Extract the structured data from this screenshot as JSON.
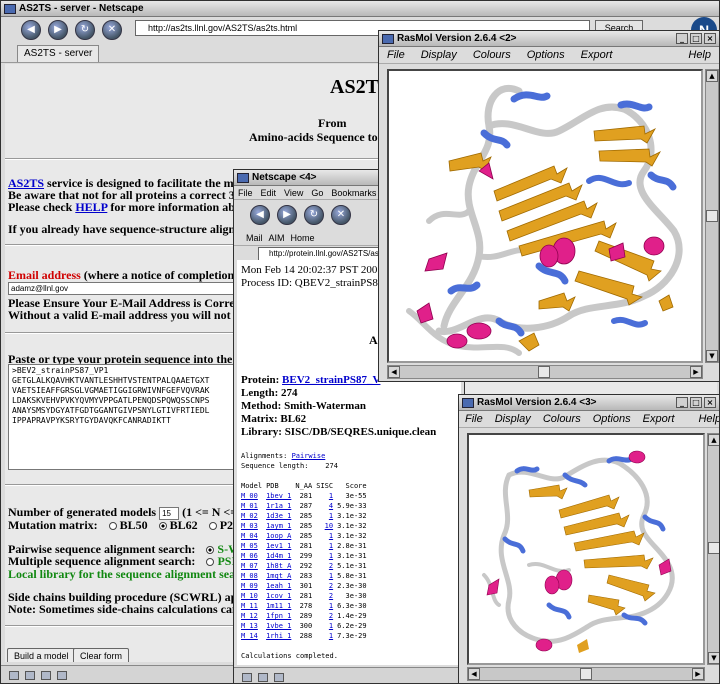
{
  "main_window": {
    "title": "AS2TS - server - Netscape",
    "url": "http://as2ts.llnl.gov/AS2TS/as2ts.html",
    "search_label": "Search",
    "logo_letter": "N",
    "tab_label": "AS2TS - server"
  },
  "page": {
    "title": "AS2TS",
    "from": "From",
    "subtitle": "Amino-acids Sequence to T",
    "intro_link": "AS2TS",
    "intro_text": " service is designed to facilitate the mode",
    "warn_text": "Be aware that not for all proteins a correct 3D m",
    "check_text": "Please check ",
    "help_link": "HELP",
    "check_text2": " for more information about",
    "already_text": "If you already have sequence-structure alignme",
    "email_label": "Email address",
    "email_note": " (where a notice of completion wil",
    "email_value": "adamz@llnl.gov",
    "ensure_text": "Please Ensure Your E-Mail Address is Correct a",
    "without_text": "Without a valid E-mail address you will not rece",
    "paste_text": "Paste or type your protein sequence into the box",
    "sequence": ">BEV2_strainPS87_VP1\nGETGLALKQAVHKTVANTLESHHTVSTENTPALQAAETGXT\nVAETSIEAFFGRSGLVGMAETIGGIGRWIVNFGEFVQVRAK\nLDAKSKVEHVPVKYQVMYVPPGATLPENQDSPQWQSSCNPS\nANAYSMSYDGYATFGDTGGANTGIVPSNYLGTIVFRTIEDL\nIPPAPRAVPYKSRYTGYDAVQKFCANRADIKTT",
    "models_label": "Number of generated models",
    "models_value": "15",
    "models_hint": "(1 <= N <= 4",
    "matrix_label": "Mutation matrix:",
    "matrix_opts": [
      "BL50",
      "BL62",
      "P25"
    ],
    "pairwise_label": "Pairwise sequence alignment search:",
    "pairwise_opt": "S-W",
    "multiple_label": "Multiple sequence alignment search:",
    "multiple_opt": "PSI-B",
    "local_lib": "Local library for the sequence alignment search",
    "side_chain": "Side chains building procedure (SCWRL) applic",
    "note_text": "Note: Sometimes side-chains calculations can ta",
    "build_btn": "Build a model",
    "clear_btn": "Clear form"
  },
  "ns4": {
    "title": "Netscape <4>",
    "menu": [
      "File",
      "Edit",
      "View",
      "Go",
      "Bookmarks",
      "T"
    ],
    "personal": [
      "Mail",
      "AIM",
      "Home"
    ],
    "url": "http://protein.llnl.gov/AS2TS/as2",
    "date_line": "Mon Feb 14 20:02:37 PST 200",
    "process_line": "Process ID: QBEV2_strainPS8",
    "letter_a": "A",
    "protein_label": "Protein: ",
    "protein_link": "BEV2_strainPS87_V",
    "length": "Length: 274",
    "method": "Method: Smith-Waterman",
    "matrix": "Matrix: BL62",
    "library": "Library: SISC/DB/SEQRES.unique.clean",
    "alignments_label": "Alignments: ",
    "alignments_link": "Pairwise",
    "seq_length": "Sequence length:    274",
    "headers": [
      "Model",
      "PDB",
      "N_AA",
      "SISC",
      "Score"
    ],
    "rows": [
      {
        "model": "M 00",
        "pdb": "1bev 1",
        "naa": "281",
        "sisc": "1",
        "score": "3e-55"
      },
      {
        "model": "M 01",
        "pdb": "1r1a 1",
        "naa": "287",
        "sisc": "4",
        "score": "5.9e-33"
      },
      {
        "model": "M 02",
        "pdb": "1d3e 1",
        "naa": "285",
        "sisc": "1",
        "score": "3.1e-32"
      },
      {
        "model": "M 03",
        "pdb": "1aym 1",
        "naa": "285",
        "sisc": "10",
        "score": "3.1e-32"
      },
      {
        "model": "M 04",
        "pdb": "1oop A",
        "naa": "285",
        "sisc": "1",
        "score": "3.1e-32"
      },
      {
        "model": "M 05",
        "pdb": "1ev1 1",
        "naa": "281",
        "sisc": "1",
        "score": "2.8e-31"
      },
      {
        "model": "M 06",
        "pdb": "1d4m 1",
        "naa": "299",
        "sisc": "1",
        "score": "3.1e-31"
      },
      {
        "model": "M 07",
        "pdb": "1h8t A",
        "naa": "292",
        "sisc": "2",
        "score": "5.1e-31"
      },
      {
        "model": "M 08",
        "pdb": "1mqt A",
        "naa": "283",
        "sisc": "1",
        "score": "5.8e-31"
      },
      {
        "model": "M 09",
        "pdb": "1eah 1",
        "naa": "301",
        "sisc": "2",
        "score": "2.3e-30"
      },
      {
        "model": "M 10",
        "pdb": "1cov 1",
        "naa": "281",
        "sisc": "2",
        "score": "3e-30"
      },
      {
        "model": "M 11",
        "pdb": "1m11 1",
        "naa": "278",
        "sisc": "1",
        "score": "6.3e-30"
      },
      {
        "model": "M 12",
        "pdb": "1fpn 1",
        "naa": "289",
        "sisc": "2",
        "score": "1.4e-29"
      },
      {
        "model": "M 13",
        "pdb": "1vbe 1",
        "naa": "300",
        "sisc": "1",
        "score": "6.2e-29"
      },
      {
        "model": "M 14",
        "pdb": "1rhi 1",
        "naa": "288",
        "sisc": "1",
        "score": "7.3e-29"
      }
    ],
    "completed": "Calculations completed."
  },
  "rasmol2": {
    "title": "RasMol Version 2.6.4 <2>",
    "menu": [
      "File",
      "Display",
      "Colours",
      "Options",
      "Export"
    ],
    "help": "Help"
  },
  "rasmol3": {
    "title": "RasMol Version 2.6.4 <3>",
    "menu": [
      "File",
      "Display",
      "Colours",
      "Options",
      "Export"
    ],
    "help": "Help"
  },
  "colors": {
    "sheet": "#e0a020",
    "helix": "#e0208a",
    "turn": "#4a6ed8",
    "coil": "#c8c8c8",
    "link": "#0000cc",
    "required": "#d00000",
    "local": "#118811"
  }
}
